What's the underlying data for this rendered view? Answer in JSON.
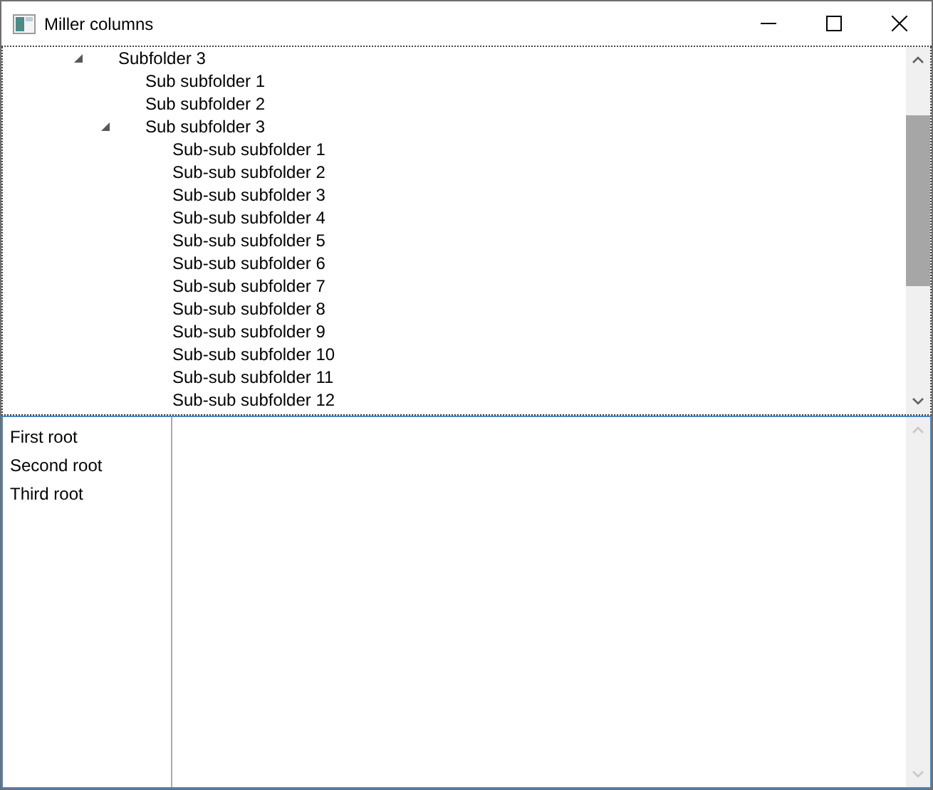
{
  "window": {
    "title": "Miller columns"
  },
  "tree": [
    {
      "label": "Subfolder 3",
      "expanded": true,
      "children": [
        {
          "label": "Sub subfolder 1"
        },
        {
          "label": "Sub subfolder 2"
        },
        {
          "label": "Sub subfolder 3",
          "expanded": true,
          "children": [
            {
              "label": "Sub-sub subfolder 1"
            },
            {
              "label": "Sub-sub subfolder 2"
            },
            {
              "label": "Sub-sub subfolder 3"
            },
            {
              "label": "Sub-sub subfolder 4"
            },
            {
              "label": "Sub-sub subfolder 5"
            },
            {
              "label": "Sub-sub subfolder 6"
            },
            {
              "label": "Sub-sub subfolder 7"
            },
            {
              "label": "Sub-sub subfolder 8"
            },
            {
              "label": "Sub-sub subfolder 9"
            },
            {
              "label": "Sub-sub subfolder 10"
            },
            {
              "label": "Sub-sub subfolder 11"
            },
            {
              "label": "Sub-sub subfolder 12"
            }
          ]
        }
      ]
    }
  ],
  "columns": [
    {
      "items": [
        {
          "label": "First root",
          "selected": false
        },
        {
          "label": "Second root",
          "selected": false
        },
        {
          "label": "Third root",
          "selected": false
        }
      ]
    }
  ]
}
